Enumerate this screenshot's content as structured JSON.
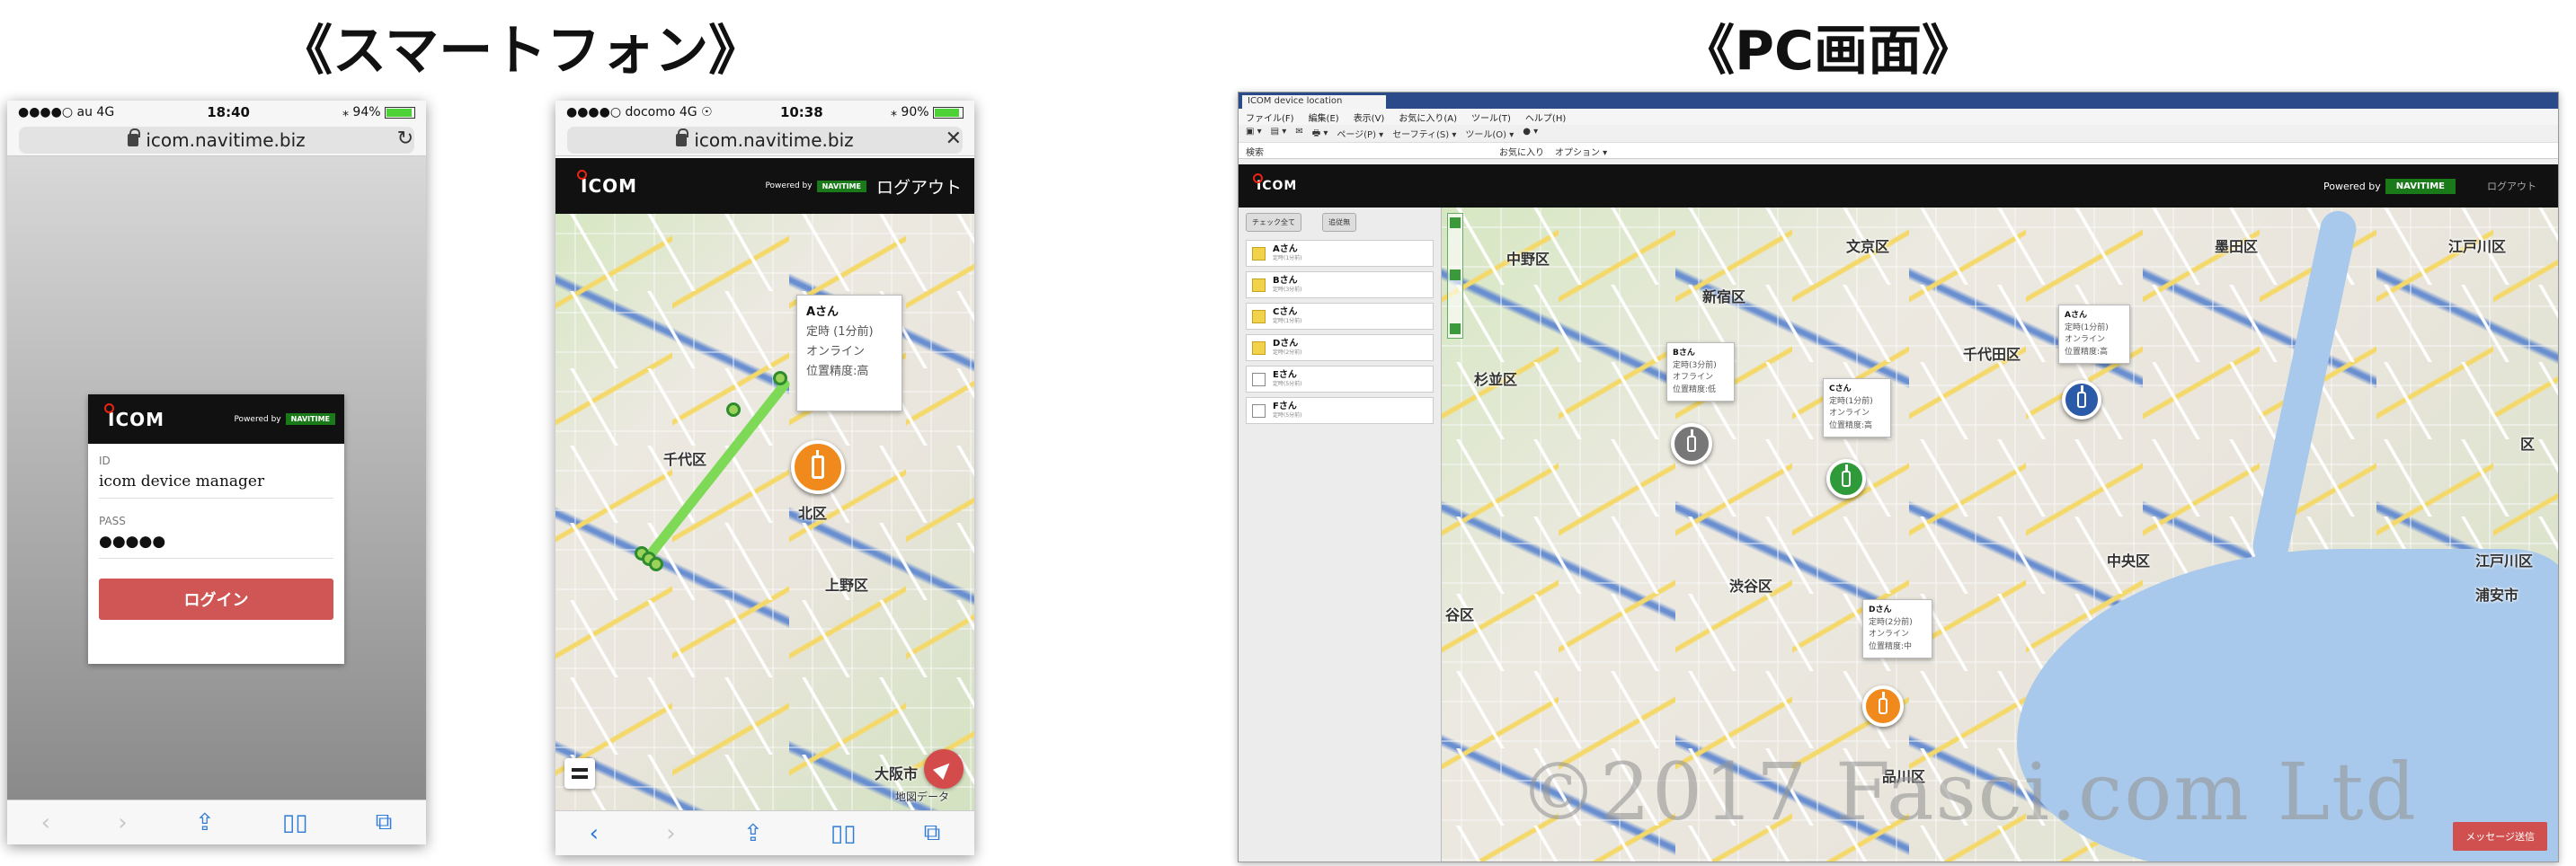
{
  "headings": {
    "smartphone": "《スマートフォン》",
    "pc": "《PC画面》"
  },
  "phone_login": {
    "status": {
      "carrier": "●●●●○ au  4G",
      "time": "18:40",
      "battery": "⁎ 94%"
    },
    "url": "icom.navitime.biz",
    "reload_icon": "↻",
    "logo": "ICOM",
    "powered_by": "Powered by",
    "navitime": "NAVITIME",
    "id_label": "ID",
    "id_value": "icom device manager",
    "pass_label": "PASS",
    "pass_value": "●●●●●",
    "login_button": "ログイン",
    "battery_level": 0.94
  },
  "phone_map": {
    "status": {
      "carrier": "●●●●○ docomo  4G ☉",
      "time": "10:38",
      "battery": "⁎ 90%"
    },
    "url": "icom.navitime.biz",
    "close_icon": "✕",
    "logo": "ICOM",
    "powered_by": "Powered by",
    "navitime": "NAVITIME",
    "logout": "ログアウト",
    "popup": {
      "name": "Aさん",
      "lines": [
        "定時 (1分前)",
        "オンライン",
        "位置精度:高"
      ]
    },
    "map_labels": [
      "上野区",
      "千代区",
      "大阪市",
      "北区",
      "地図データ"
    ],
    "battery_level": 0.9
  },
  "phone_nav": {
    "back": "‹",
    "forward": "›",
    "share": "⇪",
    "bookmarks": "▯▯",
    "tabs": "⧉"
  },
  "pc": {
    "tab_title": "ICOM device location",
    "menu": [
      "ファイル(F)",
      "編集(E)",
      "表示(V)",
      "お気に入り(A)",
      "ツール(T)",
      "ヘルプ(H)"
    ],
    "toolbar": [
      "▣ ▾",
      "▤ ▾",
      "✉",
      "🖶 ▾",
      "ページ(P) ▾",
      "セーフティ(S) ▾",
      "ツール(O) ▾",
      "● ▾"
    ],
    "address": [
      "検索",
      "お気に入り",
      "オプション ▾"
    ],
    "logo": "ICOM",
    "powered_by": "Powered by",
    "navitime": "NAVITIME",
    "logout": "ログアウト",
    "side_buttons": [
      "チェック全て",
      "追従無"
    ],
    "users": [
      {
        "name": "Aさん",
        "sub": "定時(1分前)",
        "checked": true
      },
      {
        "name": "Bさん",
        "sub": "定時(3分前)",
        "checked": true
      },
      {
        "name": "Cさん",
        "sub": "定時(1分前)",
        "checked": true
      },
      {
        "name": "Dさん",
        "sub": "定時(2分前)",
        "checked": true
      },
      {
        "name": "Eさん",
        "sub": "定時(5分前)",
        "checked": false
      },
      {
        "name": "Fさん",
        "sub": "定時(5分前)",
        "checked": false
      }
    ],
    "map_labels": [
      "中野区",
      "文京区",
      "墨田区",
      "江戸川区",
      "新宿区",
      "杉並区",
      "千代田区",
      "中央区",
      "江戸川区",
      "渋谷区",
      "浦安市",
      "品川区",
      "区",
      "谷区"
    ],
    "popups": [
      {
        "name": "Bさん",
        "lines": [
          "定時(3分前)",
          "オフライン",
          "位置精度:低"
        ]
      },
      {
        "name": "Cさん",
        "lines": [
          "定時(1分前)",
          "オンライン",
          "位置精度:高"
        ]
      },
      {
        "name": "Aさん",
        "lines": [
          "定時(1分前)",
          "オンライン",
          "位置精度:高"
        ]
      },
      {
        "name": "Dさん",
        "lines": [
          "定時(2分前)",
          "オンライン",
          "位置精度:中"
        ]
      }
    ],
    "send_button": "メッセージ送信"
  },
  "watermark": "©2017 Fasci.com Ltd",
  "colors": {
    "orange_pin": "#f08a1c",
    "green_pin": "#2e9a3a",
    "blue_pin": "#2a5aa8",
    "gray_pin": "#777777",
    "login_button": "#d05555",
    "navitime_green": "#1a7a1a"
  }
}
